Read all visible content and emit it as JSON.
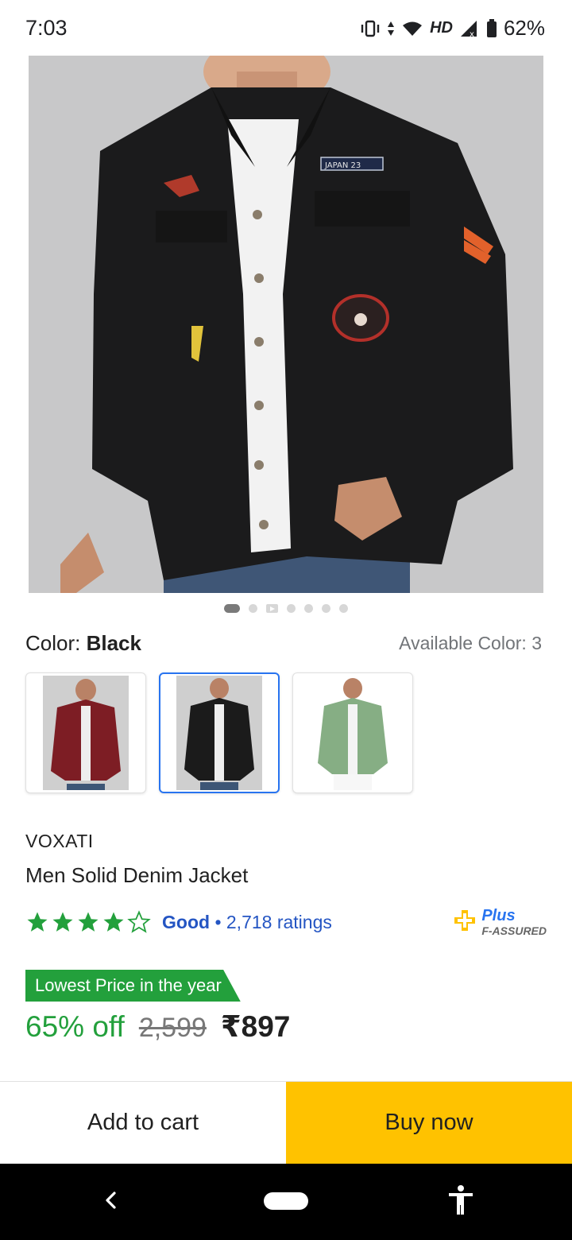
{
  "status_bar": {
    "time": "7:03",
    "network": "HD",
    "battery": "62%"
  },
  "product_images": {
    "count": 7,
    "active_index": 0,
    "video_index": 2,
    "hero_patch_text": "JAPAN 23"
  },
  "color": {
    "label": "Color:",
    "value": "Black",
    "available_text": "Available Color: 3",
    "swatches": [
      {
        "name": "maroon",
        "color": "#7d1d24",
        "selected": false
      },
      {
        "name": "black",
        "color": "#1b1b1b",
        "selected": true
      },
      {
        "name": "green",
        "color": "#86ae84",
        "selected": false
      }
    ]
  },
  "product": {
    "brand": "VOXATI",
    "title": "Men Solid Denim Jacket"
  },
  "rating": {
    "stars": 4,
    "label": "Good",
    "separator": "•",
    "count_text": "2,718 ratings"
  },
  "assured": {
    "title": "Plus",
    "subtitle": "F-ASSURED"
  },
  "pricing": {
    "deal_badge": "Lowest Price in the year",
    "discount": "65% off",
    "mrp": "2,599",
    "price": "₹897"
  },
  "actions": {
    "add_to_cart": "Add to cart",
    "buy_now": "Buy now"
  },
  "colors": {
    "accent_blue": "#2874f0",
    "green": "#23a03c",
    "buy_yellow": "#ffc200"
  }
}
